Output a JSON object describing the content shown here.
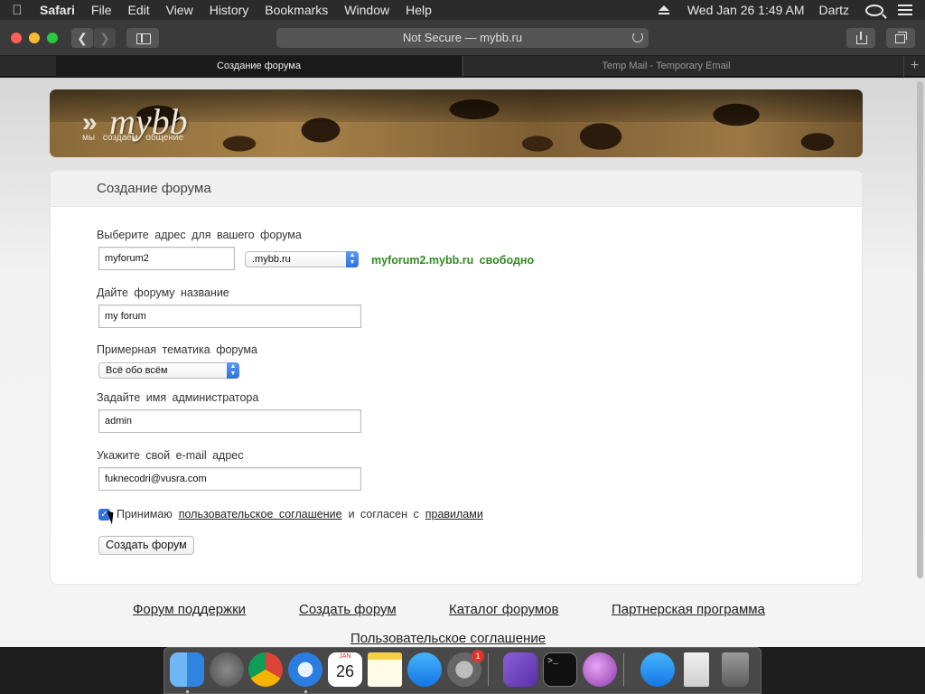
{
  "menubar": {
    "app": "Safari",
    "items": [
      "File",
      "Edit",
      "View",
      "History",
      "Bookmarks",
      "Window",
      "Help"
    ],
    "datetime": "Wed Jan 26  1:49 AM",
    "user": "Dartz"
  },
  "toolbar": {
    "url_text": "Not Secure — mybb.ru"
  },
  "tabs": [
    {
      "label": "Создание форума",
      "active": true
    },
    {
      "label": "Temp Mail - Temporary Email",
      "active": false
    }
  ],
  "banner": {
    "logo": "mybb",
    "slogan": "мы создаем общение"
  },
  "form": {
    "title": "Создание форума",
    "address_label": "Выберите адрес для вашего форума",
    "address_value": "myforum2",
    "domain_selected": ".mybb.ru",
    "availability": "myforum2.mybb.ru свободно",
    "name_label": "Дайте форуму название",
    "name_value": "my forum",
    "topic_label": "Примерная тематика форума",
    "topic_selected": "Всё обо всём",
    "admin_label": "Задайте имя администратора",
    "admin_value": "admin",
    "email_label": "Укажите свой e-mail адрес",
    "email_value": "fuknecodri@vusra.com",
    "agree_checked": true,
    "agree_prefix": "Принимаю",
    "agree_link1": "пользовательское соглашение",
    "agree_middle": "и согласен с",
    "agree_link2": "правилами",
    "submit_label": "Создать форум"
  },
  "footer": {
    "links": [
      "Форум поддержки",
      "Создать форум",
      "Каталог форумов",
      "Партнерская программа",
      "Пользовательское соглашение"
    ]
  },
  "dock": {
    "apps": [
      "Finder",
      "Launchpad",
      "Chrome",
      "Safari",
      "Calendar",
      "Notes",
      "App Store",
      "System Preferences",
      "Visual Studio",
      "Terminal",
      "Installer",
      "App Store Downloads",
      "Document",
      "Trash"
    ],
    "calendar_month": "JAN",
    "calendar_day": "26",
    "sysprefs_badge": "1"
  },
  "colors": {
    "available": "#2f8a1f",
    "accent": "#2f6fde"
  }
}
